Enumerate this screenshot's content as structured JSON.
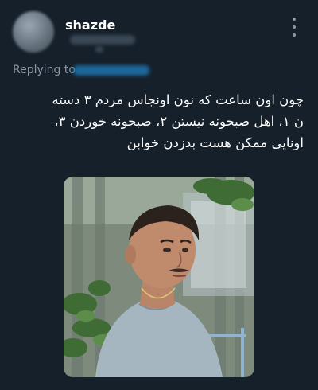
{
  "tweet": {
    "username": "shazde",
    "replying_to_label": "Replying to",
    "text_lines": [
      "چون اون ساعت که نون اونجاس مردم ۳ دسته",
      "ن ۱، اهل صبحونه نیستن ۲، صبحونه خوردن ۳،",
      "اونایی ممکن هست بدزدن خوابن"
    ],
    "more_icon": "more-vertical-icon"
  },
  "colors": {
    "background": "#15202b",
    "text": "#ffffff",
    "secondary_text": "#8b98a5",
    "link": "#1d9bf0"
  }
}
